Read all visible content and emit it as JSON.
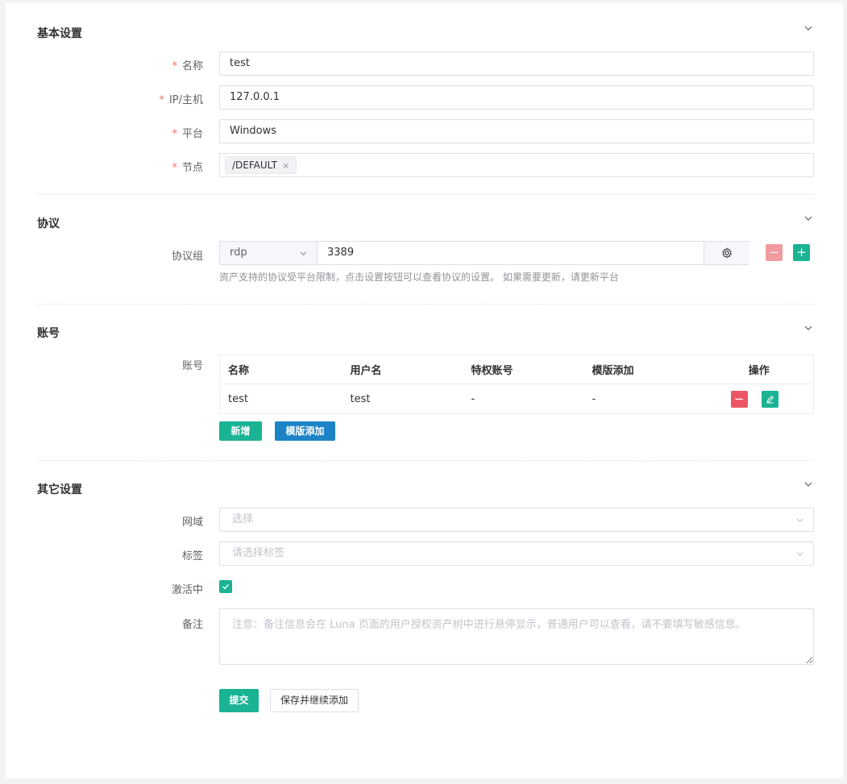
{
  "basic": {
    "title": "基本设置",
    "name_label": "名称",
    "name_value": "test",
    "host_label": "IP/主机",
    "host_value": "127.0.0.1",
    "platform_label": "平台",
    "platform_value": "Windows",
    "node_label": "节点",
    "node_tag": "/DEFAULT",
    "tag_close": "×"
  },
  "protocol": {
    "title": "协议",
    "group_label": "协议组",
    "protocol_value": "rdp",
    "port_value": "3389",
    "help": "资产支持的协议受平台限制，点击设置按钮可以查看协议的设置。 如果需要更新，请更新平台",
    "remove_symbol": "−",
    "add_symbol": "+"
  },
  "account": {
    "title": "账号",
    "label": "账号",
    "columns": [
      "名称",
      "用户名",
      "特权账号",
      "模版添加",
      "操作"
    ],
    "rows": [
      {
        "name": "test",
        "username": "test",
        "privileged": "-",
        "template": "-"
      }
    ],
    "add_button": "新增",
    "template_button": "模版添加"
  },
  "other": {
    "title": "其它设置",
    "domain_label": "网域",
    "domain_placeholder": "选择",
    "labels_label": "标签",
    "labels_placeholder": "请选择标签",
    "active_label": "激活中",
    "active_checked": true,
    "comment_label": "备注",
    "comment_placeholder": "注意：备注信息会在 Luna 页面的用户授权资产树中进行悬停显示，普通用户可以查看，请不要填写敏感信息。"
  },
  "actions": {
    "submit": "提交",
    "save_continue": "保存并继续添加"
  },
  "colors": {
    "primary": "#1ab394",
    "info": "#1c84c6",
    "danger": "#ed5565",
    "danger_light": "#f19a9f"
  },
  "icons": {
    "collapse": "chevron-down-icon",
    "settings": "gear-icon",
    "edit": "pencil-icon",
    "check": "check-icon"
  }
}
